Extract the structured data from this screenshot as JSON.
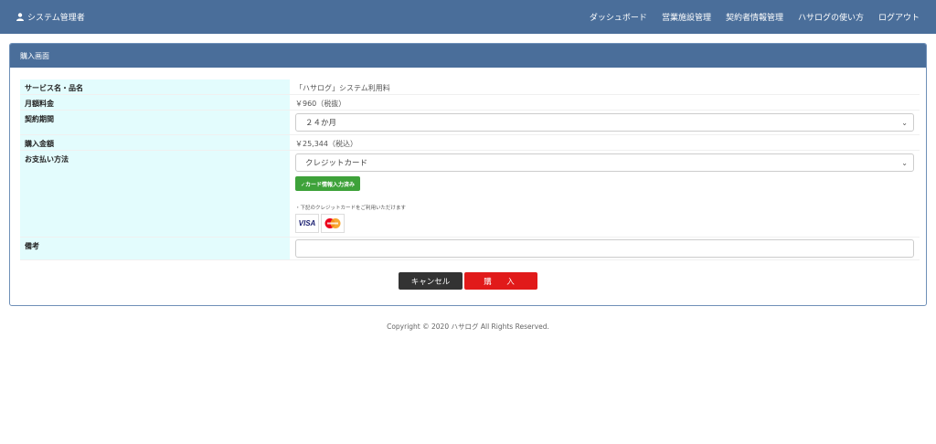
{
  "header": {
    "user_label": "システム管理者",
    "nav": [
      "ダッシュボード",
      "営業施設管理",
      "契約者情報管理",
      "ハサログの使い方",
      "ログアウト"
    ]
  },
  "panel": {
    "title": "購入画面"
  },
  "form": {
    "service": {
      "label": "サービス名・品名",
      "value": "「ハサログ」システム利用料"
    },
    "fee": {
      "label": "月額料金",
      "value": "￥960（税抜）"
    },
    "term": {
      "label": "契約期間",
      "value": "２４か月"
    },
    "amount": {
      "label": "購入金額",
      "value": "￥25,344（税込）"
    },
    "payment": {
      "label": "お支払い方法",
      "value": "クレジットカード",
      "card_button": "✓カード情報入力済み",
      "card_note": "・下記のクレジットカードをご利用いただけます",
      "logos": [
        "VISA",
        "Mastercard"
      ]
    },
    "note": {
      "label": "備考",
      "value": ""
    }
  },
  "actions": {
    "cancel": "キャンセル",
    "buy": "購　入"
  },
  "footer": {
    "copyright": "Copyright © 2020 ハサログ All Rights Reserved."
  },
  "colors": {
    "header_bg": "#4a6e9a",
    "label_bg": "#e3fcfd",
    "buy": "#e11a1a",
    "card_ok": "#3ea23a"
  }
}
